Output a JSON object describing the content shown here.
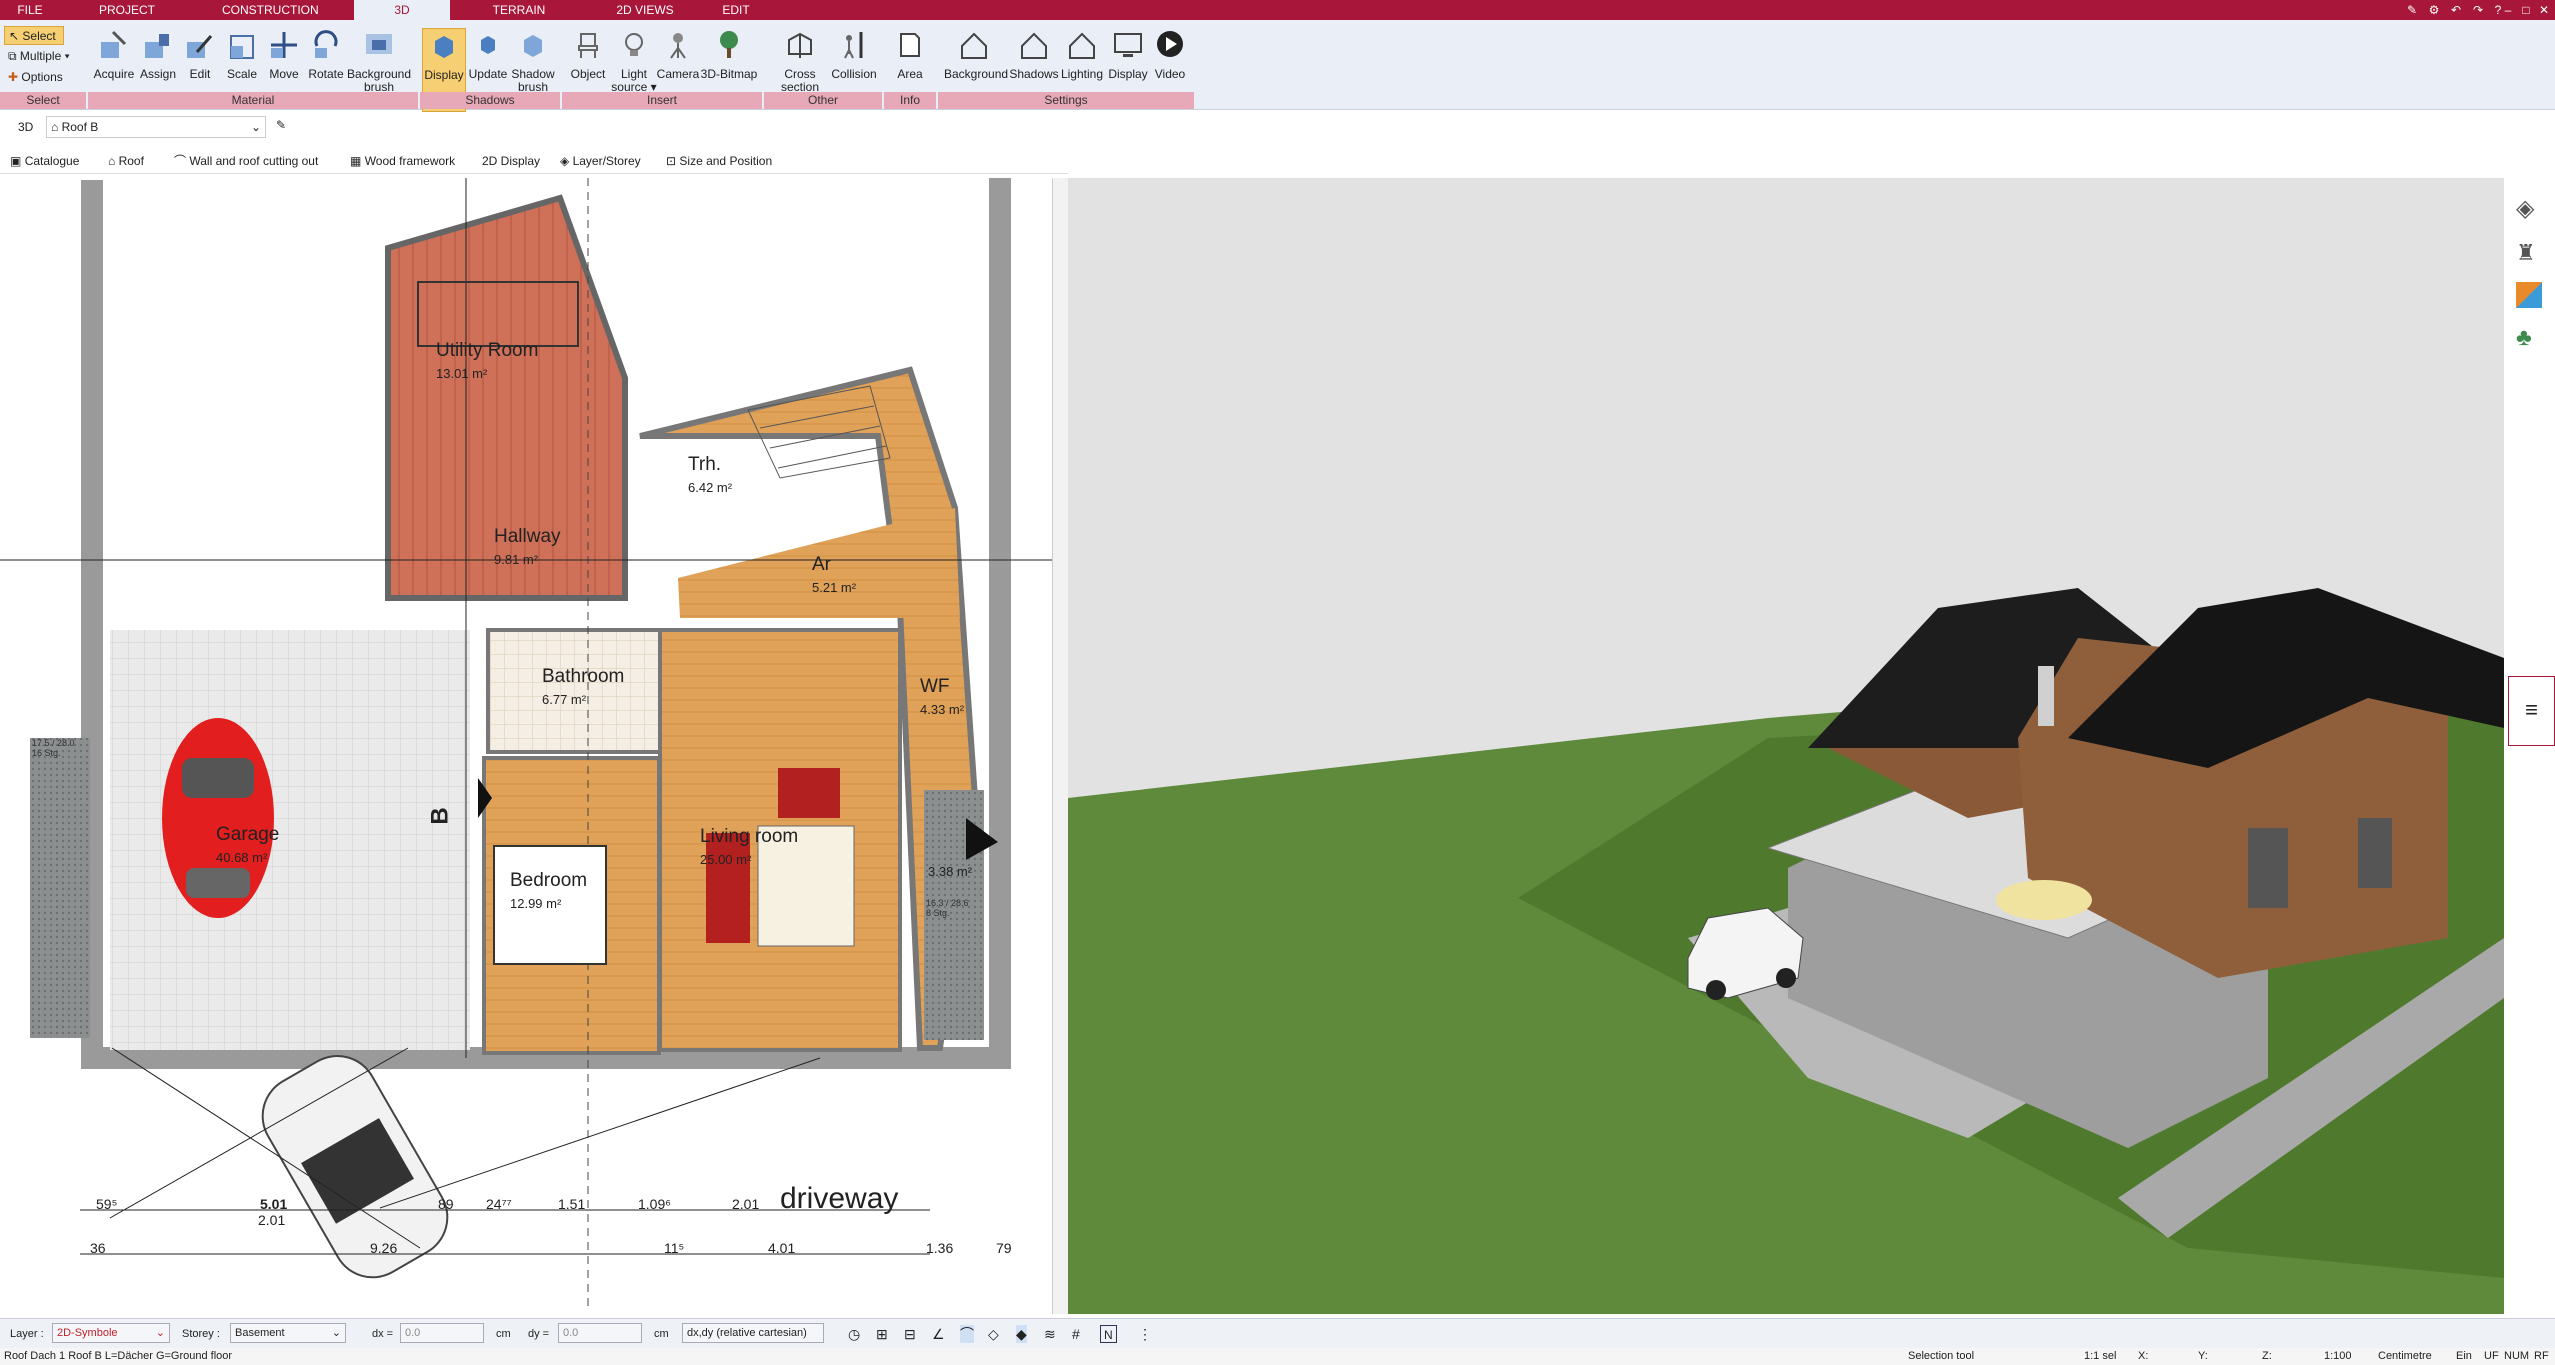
{
  "tabs": [
    {
      "label": "FILE"
    },
    {
      "label": "PROJECT"
    },
    {
      "label": "CONSTRUCTION"
    },
    {
      "label": "3D"
    },
    {
      "label": "TERRAIN"
    },
    {
      "label": "2D VIEWS"
    },
    {
      "label": "EDIT"
    }
  ],
  "ribbon": {
    "select": {
      "select_label": "Select",
      "multiple_label": "Multiple",
      "options_label": "Options"
    },
    "material": {
      "acquire": "Acquire",
      "assign": "Assign",
      "edit": "Edit",
      "scale": "Scale",
      "move": "Move",
      "rotate": "Rotate",
      "background_brush": "Background brush"
    },
    "shadows": {
      "display": "Display",
      "update": "Update",
      "shadow_brush": "Shadow brush"
    },
    "insert": {
      "object": "Object",
      "light_source": "Light source",
      "camera": "Camera",
      "bitmap3d": "3D-Bitmap"
    },
    "other": {
      "cross_section": "Cross section 3D",
      "collision": "Collision"
    },
    "info": {
      "area": "Area"
    },
    "settings": {
      "background": "Background",
      "shadows": "Shadows",
      "lighting": "Lighting",
      "display": "Display",
      "video": "Video"
    },
    "groups": {
      "select": "Select",
      "material": "Material",
      "shadows": "Shadows",
      "insert": "Insert",
      "other": "Other",
      "info": "Info",
      "settings": "Settings"
    }
  },
  "propbar": {
    "mode": "3D",
    "object": "Roof B"
  },
  "toolbar2": {
    "catalogue": "Catalogue",
    "roof": "Roof",
    "wall_roof": "Wall and roof cutting out",
    "wood": "Wood framework",
    "display2d": "2D  Display",
    "layer": "Layer/Storey",
    "size": "Size and Position"
  },
  "plan": {
    "rooms": [
      {
        "name": "Utility Room",
        "area": "13.01 m²"
      },
      {
        "name": "Hallway",
        "area": "9.81 m²"
      },
      {
        "name": "Trh.",
        "area": "6.42 m²"
      },
      {
        "name": "Ar",
        "area": "5.21 m²"
      },
      {
        "name": "Bathroom",
        "area": "6.77 m²"
      },
      {
        "name": "WF",
        "area": "4.33 m²"
      },
      {
        "name": "Garage",
        "area": "40.68 m²"
      },
      {
        "name": "Living room",
        "area": "25.00 m²"
      },
      {
        "name": "Bedroom",
        "area": "12.99 m²"
      },
      {
        "name": "",
        "area": "3.38 m²"
      }
    ],
    "stair_label_left": "17.5 / 28.0\n16 Stg.",
    "stair_label_right": "16.3 / 28.6\n8 Stg.",
    "section_marker": "B",
    "driveway": "driveway",
    "dims_row1": [
      "59⁵",
      "5.01",
      "89",
      "24⁷⁷",
      "1.51",
      "1.09⁶",
      "2.01"
    ],
    "dims_row1b": [
      "2.01"
    ],
    "dims_row2": [
      "36",
      "9.26",
      "11⁵",
      "4.01",
      "1.36",
      "79"
    ]
  },
  "status": {
    "layer_label": "Layer :",
    "layer_value": "2D-Symbole",
    "storey_label": "Storey :",
    "storey_value": "Basement",
    "dx_label": "dx =",
    "dx_value": "0.0",
    "dx_unit": "cm",
    "dy_label": "dy =",
    "dy_value": "0.0",
    "dy_unit": "cm",
    "coord_mode": "dx,dy (relative cartesian)"
  },
  "bottom": {
    "info": "Roof Dach 1 Roof B L=Dächer G=Ground floor",
    "tool": "Selection tool",
    "sel": "1:1 sel",
    "x": "X:",
    "y": "Y:",
    "z": "Z:",
    "scale": "1:100",
    "unit": "Centimetre",
    "ein": "Ein",
    "uf": "UF",
    "num": "NUM",
    "rf": "RF"
  },
  "colors": {
    "brand": "#a8173a",
    "ribbon_bg": "#e9eef7",
    "group_bar": "#e7a8b8",
    "active_btn": "#f6cf72",
    "wood_red": "#c96a4f",
    "wood_orange": "#e3a657",
    "grass": "#5f8a3c",
    "roof": "#1d1d1d",
    "car_red": "#e21e1e"
  }
}
